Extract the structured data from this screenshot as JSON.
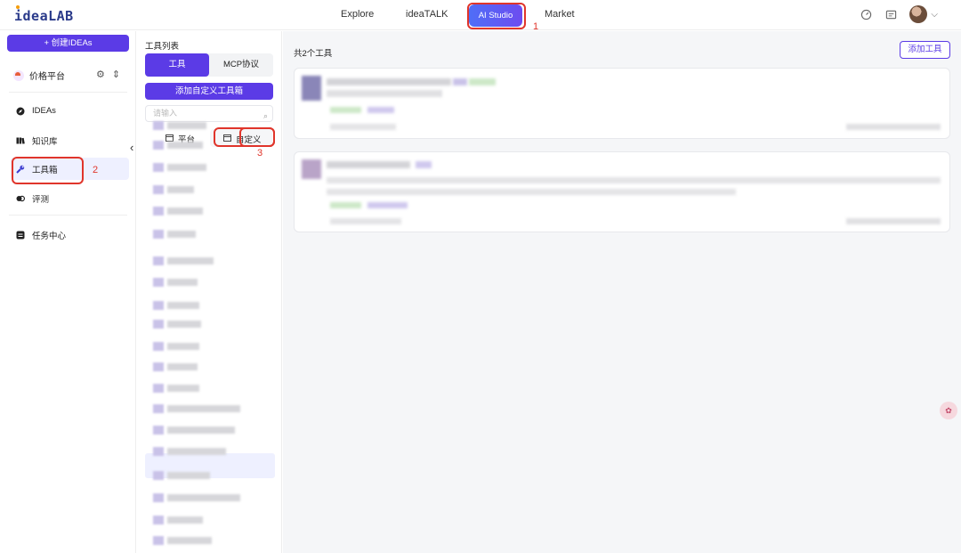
{
  "app": {
    "logo": "ideaLAB"
  },
  "nav": {
    "explore": "Explore",
    "ideatalk": "ideaTALK",
    "ai_studio": "AI Studio",
    "market": "Market"
  },
  "annotations": {
    "n1": "1",
    "n2": "2",
    "n3": "3"
  },
  "sidebar": {
    "create_button": "+  创建IDEAs",
    "org_name": "价格平台",
    "items": [
      {
        "label": "IDEAs",
        "icon": "compass-icon"
      },
      {
        "label": "知识库",
        "icon": "book-icon"
      },
      {
        "label": "工具箱",
        "icon": "wrench-icon"
      },
      {
        "label": "评测",
        "icon": "evaluation-icon"
      },
      {
        "label": "任务中心",
        "icon": "task-icon"
      }
    ]
  },
  "tools_panel": {
    "title": "工具列表",
    "tab_tools": "工具",
    "tab_mcp": "MCP协议",
    "add_custom_button": "添加自定义工具箱",
    "search_placeholder": "请输入",
    "subtab_platform": "平台",
    "subtab_custom": "自定义"
  },
  "main": {
    "count_text": "共2个工具",
    "add_tool_button": "添加工具"
  },
  "floating": {
    "label": "✿"
  },
  "colors": {
    "accent": "#5b3be6",
    "annotation": "#e0352b"
  }
}
